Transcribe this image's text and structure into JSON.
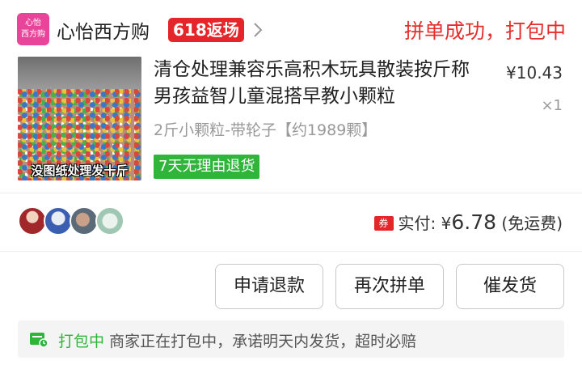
{
  "store": {
    "logo_text_line1": "心怡",
    "logo_text_line2": "西方购",
    "name": "心怡西方购",
    "promo_badge": "618返场"
  },
  "order": {
    "status": "拼单成功，打包中"
  },
  "product": {
    "image_caption": "没图纸处理发十斤",
    "title": "清仓处理兼容乐高积木玩具散装按斤称男孩益智儿童混搭早教小颗粒",
    "spec": "2斤小颗粒-带轮子【约1989颗】",
    "return_policy": "7天无理由退货",
    "unit_price": "¥10.43",
    "quantity": "×1"
  },
  "summary": {
    "coupon_label": "券",
    "paid_label": "实付:",
    "currency": "¥",
    "paid_amount": "6.78",
    "shipping_note": "(免运费)"
  },
  "actions": {
    "refund": "申请退款",
    "regroup": "再次拼单",
    "urge_shipping": "催发货"
  },
  "notice": {
    "status": "打包中",
    "detail": "商家正在打包中，承诺明天内发货，超时必赔"
  },
  "colors": {
    "accent_red": "#e3302e",
    "promo_red": "#e4262b",
    "success_green": "#2fb53a",
    "brand_pink": "#e8449a"
  },
  "icons": [
    "chevron-right-icon",
    "coupon-icon",
    "box-icon"
  ]
}
